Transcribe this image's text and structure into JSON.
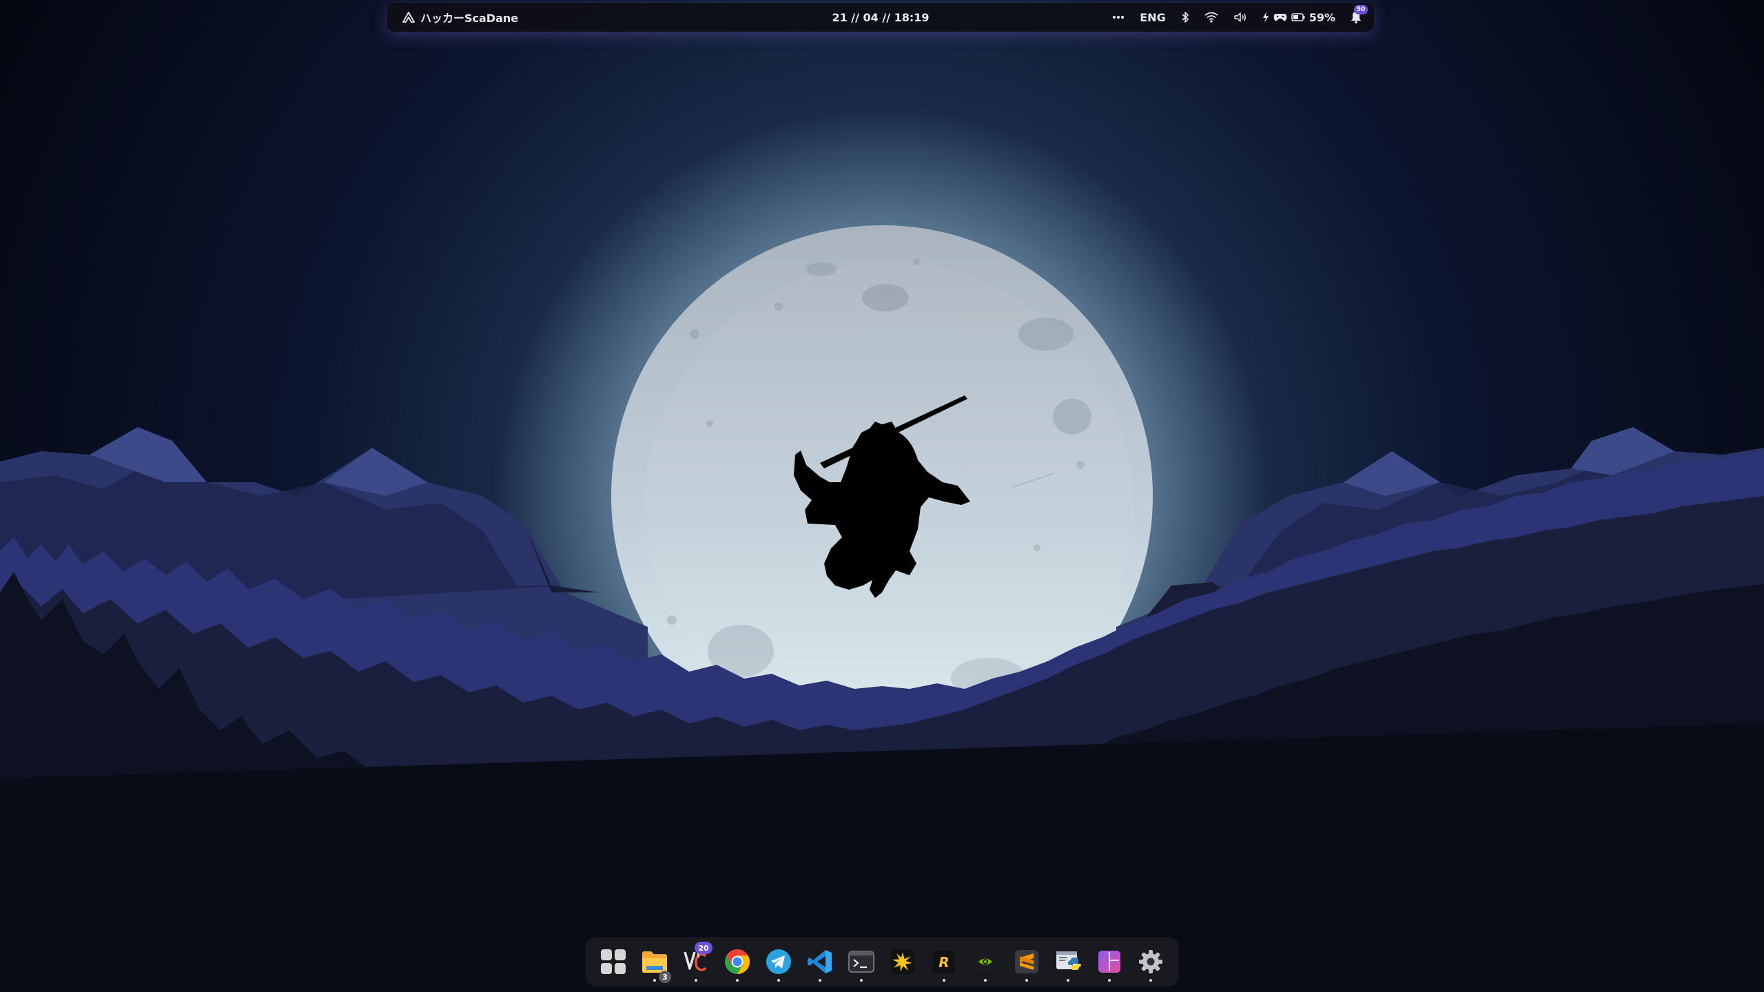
{
  "topbar": {
    "user_label": "ハッカーScaDane",
    "datetime": "21 // 04 // 18:19",
    "language": "ENG",
    "battery": "59%",
    "notification_count": "50"
  },
  "dock": {
    "items": [
      {
        "id": "app-grid",
        "icon": "app-grid-icon"
      },
      {
        "id": "files",
        "icon": "folder-icon",
        "count": "3"
      },
      {
        "id": "vc",
        "icon": "vc-icon",
        "badge": "20"
      },
      {
        "id": "chrome",
        "icon": "chrome-icon"
      },
      {
        "id": "telegram",
        "icon": "telegram-icon"
      },
      {
        "id": "vscode",
        "icon": "vscode-icon"
      },
      {
        "id": "terminal",
        "icon": "terminal-icon"
      },
      {
        "id": "sparkle",
        "icon": "sparkle-icon"
      },
      {
        "id": "rider",
        "icon": "rider-icon"
      },
      {
        "id": "nvidia",
        "icon": "nvidia-icon"
      },
      {
        "id": "sublime",
        "icon": "sublime-icon"
      },
      {
        "id": "python",
        "icon": "python-icon"
      },
      {
        "id": "tiling",
        "icon": "tiling-icon"
      },
      {
        "id": "settings",
        "icon": "gear-icon"
      }
    ]
  },
  "colors": {
    "accent": "#6f52d9",
    "bar_bg": "#0e0f18",
    "sky_top": "#06091a",
    "moon": "#c5d2dc"
  }
}
